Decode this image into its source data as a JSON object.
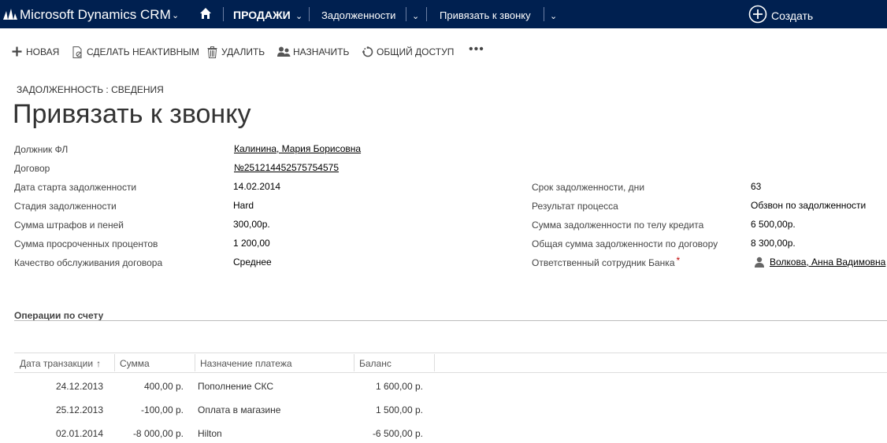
{
  "topbar": {
    "app_title": "Microsoft Dynamics CRM",
    "area": "ПРОДАЖИ",
    "entity": "Задолженности",
    "record": "Привязать к звонку",
    "create_label": "Создать",
    "bg_color": "#002050"
  },
  "commands": [
    {
      "label": "НОВАЯ",
      "icon": "plus-icon"
    },
    {
      "label": "СДЕЛАТЬ НЕАКТИВНЫМ",
      "icon": "deactivate-icon"
    },
    {
      "label": "УДАЛИТЬ",
      "icon": "trash-icon"
    },
    {
      "label": "НАЗНАЧИТЬ",
      "icon": "assign-icon"
    },
    {
      "label": "ОБЩИЙ ДОСТУП",
      "icon": "share-icon"
    }
  ],
  "header": {
    "entity_label": "ЗАДОЛЖЕННОСТЬ : СВЕДЕНИЯ",
    "title": "Привязать к звонку"
  },
  "fields_left": [
    {
      "label": "Должник ФЛ",
      "value": "Калинина, Мария Борисовна"
    },
    {
      "label": "Договор",
      "value": "№251214452575754575"
    },
    {
      "label": "Дата старта задолженности",
      "value": "14.02.2014"
    },
    {
      "label": "Стадия задолженности",
      "value": "Hard"
    },
    {
      "label": "Сумма штрафов и пеней",
      "value": "300,00р."
    },
    {
      "label": "Сумма просроченных процентов",
      "value": "1 200,00"
    },
    {
      "label": "Качество обслуживания договора",
      "value": "Среднее"
    }
  ],
  "fields_right": [
    {
      "label": "Срок задолженности, дни",
      "value": "63"
    },
    {
      "label": "Результат процесса",
      "value": "Обзвон по задолженности"
    },
    {
      "label": "Сумма задолженности по телу кредита",
      "value": "6 500,00р."
    },
    {
      "label": "Общая сумма задолженности по договору",
      "value": "8 300,00р."
    },
    {
      "label": "Ответственный сотрудник Банка",
      "required_mark": "*",
      "value": "Волкова, Анна Вадимовна"
    }
  ],
  "section": {
    "title": "Операции по счету"
  },
  "grid": {
    "columns": [
      "Дата транзакции",
      "Сумма",
      "Назначение платежа",
      "Баланс"
    ],
    "sort_icon": "arrow-up-icon",
    "rows": [
      [
        "24.12.2013",
        "400,00 р.",
        "Пополнение СКС",
        "1 600,00 р."
      ],
      [
        "25.12.2013",
        "-100,00 р.",
        "Оплата в магазине",
        "1 500,00 р."
      ],
      [
        "02.01.2014",
        "-8 000,00 р.",
        "Hilton",
        "-6 500,00 р."
      ]
    ]
  }
}
